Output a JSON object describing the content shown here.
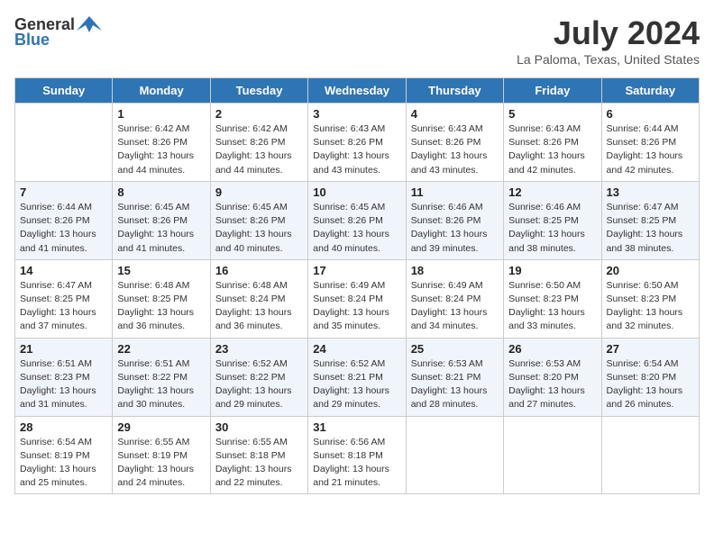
{
  "header": {
    "logo_general": "General",
    "logo_blue": "Blue",
    "month_title": "July 2024",
    "location": "La Paloma, Texas, United States"
  },
  "days_of_week": [
    "Sunday",
    "Monday",
    "Tuesday",
    "Wednesday",
    "Thursday",
    "Friday",
    "Saturday"
  ],
  "weeks": [
    [
      {
        "day": "",
        "info": ""
      },
      {
        "day": "1",
        "info": "Sunrise: 6:42 AM\nSunset: 8:26 PM\nDaylight: 13 hours\nand 44 minutes."
      },
      {
        "day": "2",
        "info": "Sunrise: 6:42 AM\nSunset: 8:26 PM\nDaylight: 13 hours\nand 44 minutes."
      },
      {
        "day": "3",
        "info": "Sunrise: 6:43 AM\nSunset: 8:26 PM\nDaylight: 13 hours\nand 43 minutes."
      },
      {
        "day": "4",
        "info": "Sunrise: 6:43 AM\nSunset: 8:26 PM\nDaylight: 13 hours\nand 43 minutes."
      },
      {
        "day": "5",
        "info": "Sunrise: 6:43 AM\nSunset: 8:26 PM\nDaylight: 13 hours\nand 42 minutes."
      },
      {
        "day": "6",
        "info": "Sunrise: 6:44 AM\nSunset: 8:26 PM\nDaylight: 13 hours\nand 42 minutes."
      }
    ],
    [
      {
        "day": "7",
        "info": "Sunrise: 6:44 AM\nSunset: 8:26 PM\nDaylight: 13 hours\nand 41 minutes."
      },
      {
        "day": "8",
        "info": "Sunrise: 6:45 AM\nSunset: 8:26 PM\nDaylight: 13 hours\nand 41 minutes."
      },
      {
        "day": "9",
        "info": "Sunrise: 6:45 AM\nSunset: 8:26 PM\nDaylight: 13 hours\nand 40 minutes."
      },
      {
        "day": "10",
        "info": "Sunrise: 6:45 AM\nSunset: 8:26 PM\nDaylight: 13 hours\nand 40 minutes."
      },
      {
        "day": "11",
        "info": "Sunrise: 6:46 AM\nSunset: 8:26 PM\nDaylight: 13 hours\nand 39 minutes."
      },
      {
        "day": "12",
        "info": "Sunrise: 6:46 AM\nSunset: 8:25 PM\nDaylight: 13 hours\nand 38 minutes."
      },
      {
        "day": "13",
        "info": "Sunrise: 6:47 AM\nSunset: 8:25 PM\nDaylight: 13 hours\nand 38 minutes."
      }
    ],
    [
      {
        "day": "14",
        "info": "Sunrise: 6:47 AM\nSunset: 8:25 PM\nDaylight: 13 hours\nand 37 minutes."
      },
      {
        "day": "15",
        "info": "Sunrise: 6:48 AM\nSunset: 8:25 PM\nDaylight: 13 hours\nand 36 minutes."
      },
      {
        "day": "16",
        "info": "Sunrise: 6:48 AM\nSunset: 8:24 PM\nDaylight: 13 hours\nand 36 minutes."
      },
      {
        "day": "17",
        "info": "Sunrise: 6:49 AM\nSunset: 8:24 PM\nDaylight: 13 hours\nand 35 minutes."
      },
      {
        "day": "18",
        "info": "Sunrise: 6:49 AM\nSunset: 8:24 PM\nDaylight: 13 hours\nand 34 minutes."
      },
      {
        "day": "19",
        "info": "Sunrise: 6:50 AM\nSunset: 8:23 PM\nDaylight: 13 hours\nand 33 minutes."
      },
      {
        "day": "20",
        "info": "Sunrise: 6:50 AM\nSunset: 8:23 PM\nDaylight: 13 hours\nand 32 minutes."
      }
    ],
    [
      {
        "day": "21",
        "info": "Sunrise: 6:51 AM\nSunset: 8:23 PM\nDaylight: 13 hours\nand 31 minutes."
      },
      {
        "day": "22",
        "info": "Sunrise: 6:51 AM\nSunset: 8:22 PM\nDaylight: 13 hours\nand 30 minutes."
      },
      {
        "day": "23",
        "info": "Sunrise: 6:52 AM\nSunset: 8:22 PM\nDaylight: 13 hours\nand 29 minutes."
      },
      {
        "day": "24",
        "info": "Sunrise: 6:52 AM\nSunset: 8:21 PM\nDaylight: 13 hours\nand 29 minutes."
      },
      {
        "day": "25",
        "info": "Sunrise: 6:53 AM\nSunset: 8:21 PM\nDaylight: 13 hours\nand 28 minutes."
      },
      {
        "day": "26",
        "info": "Sunrise: 6:53 AM\nSunset: 8:20 PM\nDaylight: 13 hours\nand 27 minutes."
      },
      {
        "day": "27",
        "info": "Sunrise: 6:54 AM\nSunset: 8:20 PM\nDaylight: 13 hours\nand 26 minutes."
      }
    ],
    [
      {
        "day": "28",
        "info": "Sunrise: 6:54 AM\nSunset: 8:19 PM\nDaylight: 13 hours\nand 25 minutes."
      },
      {
        "day": "29",
        "info": "Sunrise: 6:55 AM\nSunset: 8:19 PM\nDaylight: 13 hours\nand 24 minutes."
      },
      {
        "day": "30",
        "info": "Sunrise: 6:55 AM\nSunset: 8:18 PM\nDaylight: 13 hours\nand 22 minutes."
      },
      {
        "day": "31",
        "info": "Sunrise: 6:56 AM\nSunset: 8:18 PM\nDaylight: 13 hours\nand 21 minutes."
      },
      {
        "day": "",
        "info": ""
      },
      {
        "day": "",
        "info": ""
      },
      {
        "day": "",
        "info": ""
      }
    ]
  ]
}
